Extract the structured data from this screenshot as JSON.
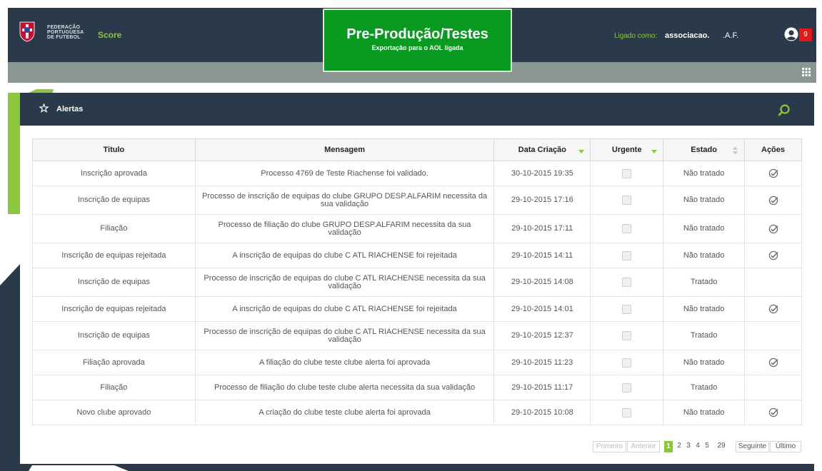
{
  "header": {
    "logo_text": [
      "FEDERAÇÃO",
      "PORTUGUESA",
      "DE FUTEBOL"
    ],
    "app_name": "Score",
    "environment_title": "Pre-Produção/Testes",
    "environment_subtitle": "Exportação para o AOL ligada",
    "logged_label": "Ligado como:",
    "logged_user": "associacao.",
    "logged_org": ".A.F.",
    "notification_count": "9"
  },
  "panel": {
    "title": "Alertas",
    "icons": {
      "title": "star-icon",
      "search": "search-icon"
    }
  },
  "table": {
    "columns": [
      "Titulo",
      "Mensagem",
      "Data Criação",
      "Urgente",
      "Estado",
      "Ações"
    ],
    "rows": [
      {
        "titulo": "Inscrição aprovada",
        "mensagem": "Processo 4769 de Teste Riachense foi validado.",
        "data": "30-10-2015 19:35",
        "estado": "Não tratado",
        "acao": true
      },
      {
        "titulo": "Inscrição de equipas",
        "mensagem": "Processo de inscrição de equipas do clube GRUPO DESP.ALFARIM necessita da sua validação",
        "data": "29-10-2015 17:16",
        "estado": "Não tratado",
        "acao": true
      },
      {
        "titulo": "Filiação",
        "mensagem": "Processo de filiação do clube GRUPO DESP.ALFARIM necessita da sua validação",
        "data": "29-10-2015 17:11",
        "estado": "Não tratado",
        "acao": true
      },
      {
        "titulo": "Inscrição de equipas rejeitada",
        "mensagem": "A inscrição de equipas do clube C ATL RIACHENSE foi rejeitada",
        "data": "29-10-2015 14:11",
        "estado": "Não tratado",
        "acao": true
      },
      {
        "titulo": "Inscrição de equipas",
        "mensagem": "Processo de inscrição de equipas do clube C ATL RIACHENSE necessita da sua validação",
        "data": "29-10-2015 14:08",
        "estado": "Tratado",
        "acao": false
      },
      {
        "titulo": "Inscrição de equipas rejeitada",
        "mensagem": "A inscrição de equipas do clube C ATL RIACHENSE foi rejeitada",
        "data": "29-10-2015 14:01",
        "estado": "Não tratado",
        "acao": true
      },
      {
        "titulo": "Inscrição de equipas",
        "mensagem": "Processo de inscrição de equipas do clube C ATL RIACHENSE necessita da sua validação",
        "data": "29-10-2015 12:37",
        "estado": "Tratado",
        "acao": false
      },
      {
        "titulo": "Filiação aprovada",
        "mensagem": "A filiação do clube teste clube alerta foi aprovada",
        "data": "29-10-2015 11:23",
        "estado": "Não tratado",
        "acao": true
      },
      {
        "titulo": "Filiação",
        "mensagem": "Processo de filiação do clube teste clube alerta necessita da sua validação",
        "data": "29-10-2015 11:17",
        "estado": "Tratado",
        "acao": false
      },
      {
        "titulo": "Novo clube aprovado",
        "mensagem": "A criação do clube teste clube alerta foi aprovada",
        "data": "29-10-2015 10:08",
        "estado": "Não tratado",
        "acao": true
      }
    ]
  },
  "pagination": {
    "first": "Primeiro",
    "previous": "Anterior",
    "pages": [
      "1",
      "2",
      "3",
      "4",
      "5",
      "29"
    ],
    "current": "1",
    "next": "Seguinte",
    "last": "Último"
  },
  "colors": {
    "header_bg": "#2b3a4a",
    "accent_green": "#8cc63f",
    "environment_green": "#0a9a21",
    "badge_red": "#e01a1a"
  }
}
